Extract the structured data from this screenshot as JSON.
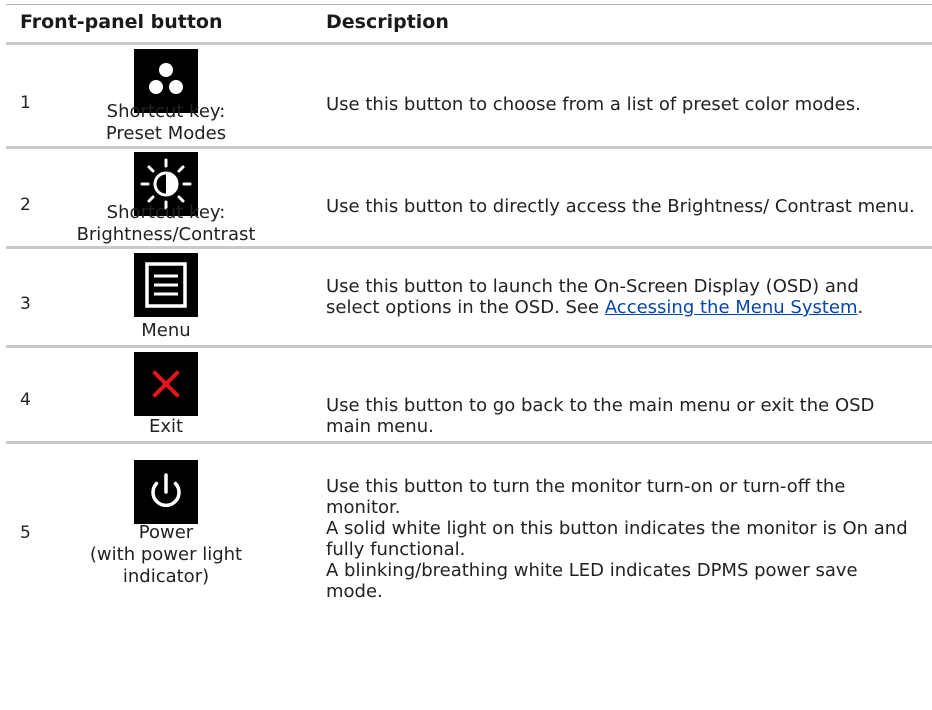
{
  "header": {
    "button_col": "Front-panel button",
    "description_col": "Description"
  },
  "rows": [
    {
      "number": "1",
      "icon": "three-dots-icon",
      "caption_lines": [
        "Shortcut key:",
        "Preset Modes"
      ],
      "description": "Use this button to choose from a list of preset color modes."
    },
    {
      "number": "2",
      "icon": "brightness-contrast-icon",
      "caption_lines": [
        "Shortcut key:",
        "Brightness/Contrast"
      ],
      "description": "Use this button to directly access the Brightness/ Contrast menu."
    },
    {
      "number": "3",
      "icon": "menu-icon",
      "caption_lines": [
        "Menu"
      ],
      "description_before_link": "Use this button to launch the On-Screen Display (OSD) and select options in the OSD. See ",
      "description_link": "Accessing the Menu System",
      "description_after_link": "."
    },
    {
      "number": "4",
      "icon": "exit-x-icon",
      "caption_lines": [
        "Exit"
      ],
      "description": "Use this button to go back to the main menu or exit the OSD main menu."
    },
    {
      "number": "5",
      "icon": "power-icon",
      "caption_lines": [
        "Power",
        "(with power light",
        "indicator)"
      ],
      "description_lines": [
        "Use this button to turn the monitor turn-on or turn-off the monitor.",
        "A solid white light on this button indicates the monitor is On and fully functional.",
        "A blinking/breathing white LED indicates DPMS power save mode."
      ]
    }
  ],
  "colors": {
    "icon_background": "#000000",
    "exit_icon": "#e8141c",
    "link": "#0645ad",
    "rule": "#c9c9c9"
  }
}
